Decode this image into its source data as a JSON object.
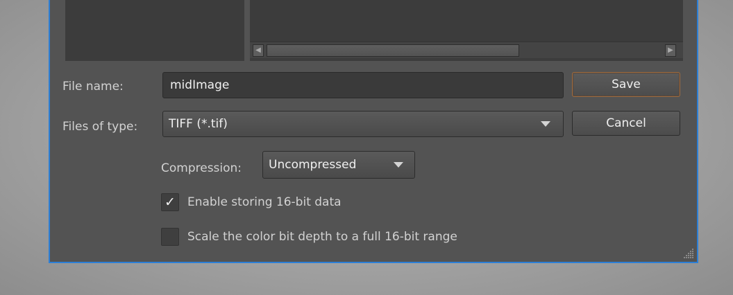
{
  "dialog": {
    "file_name": {
      "label": "File name:",
      "value": "midImage"
    },
    "files_of_type": {
      "label": "Files of type:",
      "selected": "TIFF (*.tif)"
    },
    "buttons": {
      "save": "Save",
      "cancel": "Cancel"
    },
    "compression": {
      "label": "Compression:",
      "selected": "Uncompressed"
    },
    "options": [
      {
        "label": "Enable storing 16-bit data",
        "checked": true,
        "check_glyph": "✓"
      },
      {
        "label": "Scale the color bit depth to a full 16-bit range",
        "checked": false,
        "check_glyph": ""
      }
    ]
  },
  "icons": {
    "dropdown": "triangle-down-icon",
    "scroll_left": "triangle-left-icon",
    "scroll_right": "triangle-right-icon",
    "resize": "resize-grip-icon"
  },
  "colors": {
    "dialog_bg": "#535353",
    "dialog_border": "#2c7fd6",
    "default_button_outline": "#9d6d43"
  }
}
